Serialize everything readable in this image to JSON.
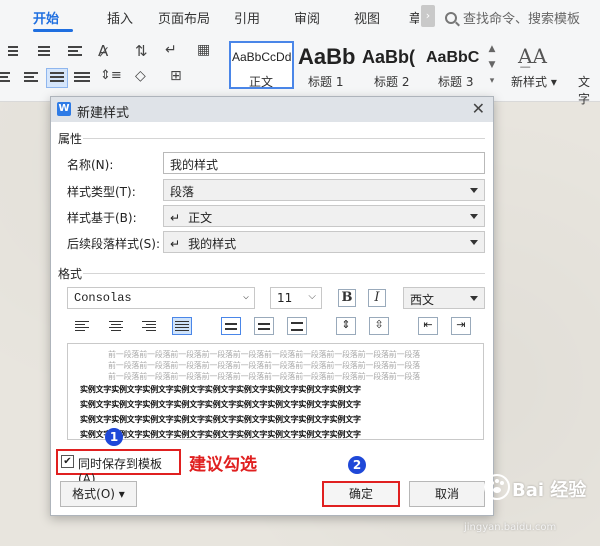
{
  "ribbon": {
    "tabs": [
      "开始",
      "插入",
      "页面布局",
      "引用",
      "审阅",
      "视图",
      "章"
    ],
    "active_tab": "开始",
    "search_placeholder": "查找命令、搜索模板",
    "styles": [
      {
        "sample": "AaBbCcDd",
        "label": "正文"
      },
      {
        "sample": "AaBb",
        "label": "标题 1"
      },
      {
        "sample": "AaBb(",
        "label": "标题 2"
      },
      {
        "sample": "AaBbC",
        "label": "标题 3"
      }
    ],
    "new_style_label": "新样式",
    "text_tools_label": "文字",
    "accent_color": "#1f6fe0"
  },
  "dialog": {
    "title": "新建样式",
    "properties_heading": "属性",
    "name_label": "名称(N):",
    "name_value": "我的样式",
    "type_label": "样式类型(T):",
    "type_value": "段落",
    "based_on_label": "样式基于(B):",
    "based_on_value": "正文",
    "next_label": "后续段落样式(S):",
    "next_value": "我的样式",
    "format_heading": "格式",
    "font_value": "Consolas",
    "size_value": "11",
    "bold_label": "B",
    "italic_label": "I",
    "script_value": "西文",
    "preview": {
      "prev_line": "前一段落前一段落前一段落前一段落前一段落前一段落前一段落前一段落前一段落前一段落",
      "sample_line": "实例文字实例文字实例文字实例文字实例文字实例文字实例文字实例文字实例文字"
    },
    "save_to_template_label": "同时保存到模板(A)",
    "save_to_template_checked": true,
    "format_button": "格式(O)",
    "ok_button": "确定",
    "cancel_button": "取消"
  },
  "annotations": {
    "badge1": "1",
    "badge2": "2",
    "note": "建议勾选",
    "color": "#e02020"
  },
  "watermark": {
    "name": "Bai 经验",
    "url": "jingyan.baidu.com"
  }
}
